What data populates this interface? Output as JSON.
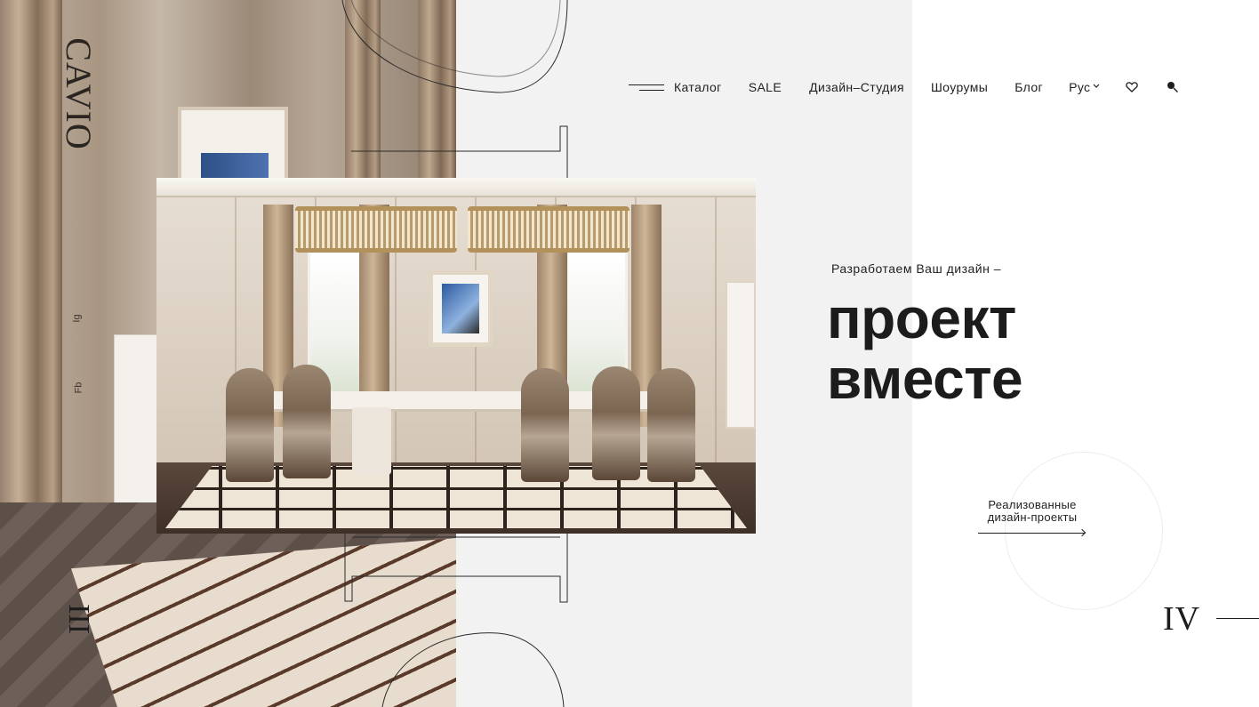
{
  "brand": {
    "logo_text": "CAVIO"
  },
  "social": {
    "instagram": "Ig",
    "facebook": "Fb"
  },
  "nav": {
    "menu_icon": "hamburger-icon",
    "items": [
      "Каталог",
      "SALE",
      "Дизайн–Студия",
      "Шоурумы",
      "Блог"
    ],
    "language": "Рус",
    "favorites_icon": "heart-icon",
    "search_icon": "search-icon"
  },
  "hero": {
    "eyebrow": "Разработаем Ваш дизайн –",
    "headline_line1": "проект",
    "headline_line2": "вместе",
    "photo": "dining-room-interior"
  },
  "projects_link": {
    "line1": "Реализованные",
    "line2": "дизайн-проекты"
  },
  "slider": {
    "current": "IV",
    "previous": "III"
  },
  "colors": {
    "text": "#1f1f1f",
    "middle_panel": "#f2f2f2",
    "background": "#ffffff"
  }
}
